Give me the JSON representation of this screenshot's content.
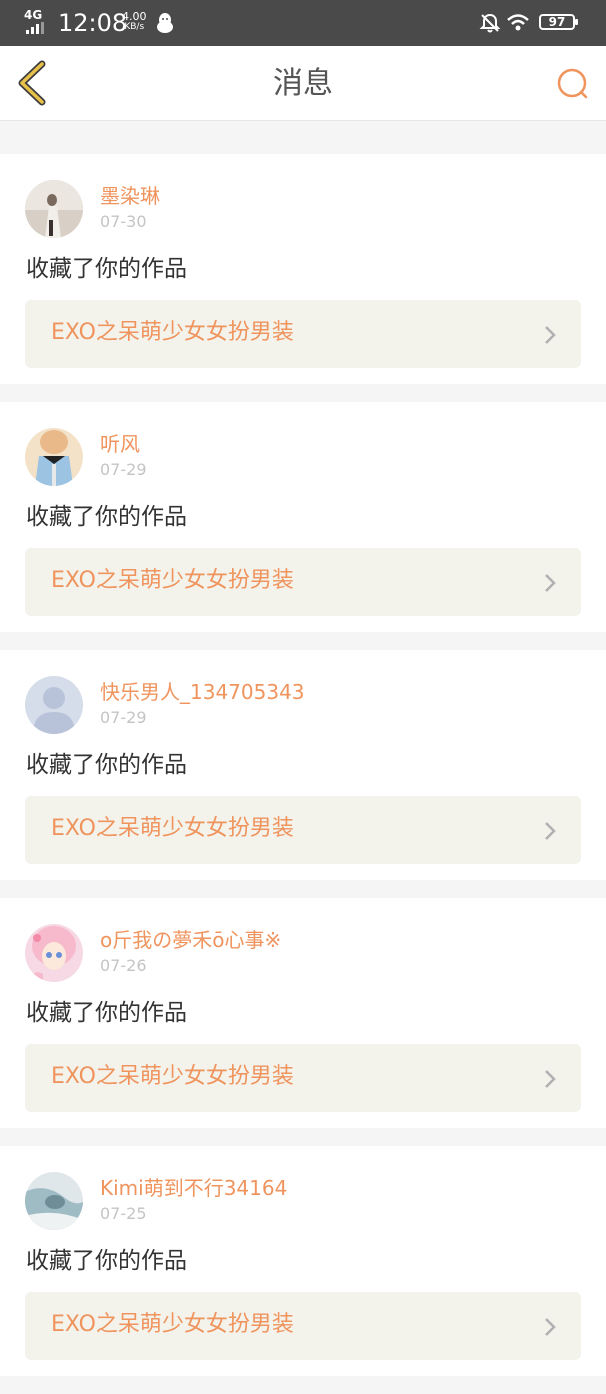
{
  "status_bar": {
    "network": "4G",
    "time": "12:08",
    "speed_value": "4.00",
    "speed_unit": "KB/s",
    "battery": "97"
  },
  "header": {
    "title": "消息"
  },
  "colors": {
    "accent": "#f0945e",
    "back_icon": "#e8c14a",
    "card_link_bg": "#f3f3ec"
  },
  "messages": [
    {
      "username": "墨染琳",
      "date": "07-30",
      "action": "收藏了你的作品",
      "work_title": "EXO之呆萌少女女扮男装"
    },
    {
      "username": "听风",
      "date": "07-29",
      "action": "收藏了你的作品",
      "work_title": "EXO之呆萌少女女扮男装"
    },
    {
      "username": "快乐男人_134705343",
      "date": "07-29",
      "action": "收藏了你的作品",
      "work_title": "EXO之呆萌少女女扮男装"
    },
    {
      "username": "o斤我の夢禾ō心事※",
      "date": "07-26",
      "action": "收藏了你的作品",
      "work_title": "EXO之呆萌少女女扮男装"
    },
    {
      "username": "Kimi萌到不行34164",
      "date": "07-25",
      "action": "收藏了你的作品",
      "work_title": "EXO之呆萌少女女扮男装"
    }
  ]
}
